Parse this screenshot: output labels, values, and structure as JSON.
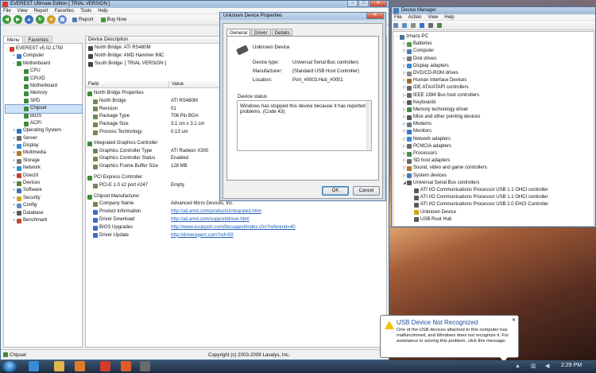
{
  "everest": {
    "title": "EVEREST Ultimate Edition  [ TRIAL VERSION ]",
    "menu": [
      "File",
      "View",
      "Report",
      "Favorites",
      "Tools",
      "Help"
    ],
    "report_label": "Report",
    "buynow_label": "Buy Now",
    "tabs": [
      "Menu",
      "Favorites"
    ],
    "tree": [
      {
        "label": "EVEREST v5.02.1750",
        "level": 0,
        "color": "#d33b2c"
      },
      {
        "label": "Computer",
        "level": 1,
        "color": "#3c7bd1",
        "exp": "+"
      },
      {
        "label": "Motherboard",
        "level": 1,
        "color": "#3f8a3f",
        "exp": "−"
      },
      {
        "label": "CPU",
        "level": 2,
        "color": "#3f8a3f"
      },
      {
        "label": "CPUID",
        "level": 2,
        "color": "#3f8a3f"
      },
      {
        "label": "Motherboard",
        "level": 2,
        "color": "#3f8a3f"
      },
      {
        "label": "Memory",
        "level": 2,
        "color": "#3f8a3f"
      },
      {
        "label": "SPD",
        "level": 2,
        "color": "#3f8a3f"
      },
      {
        "label": "Chipset",
        "level": 2,
        "color": "#3f8a3f",
        "selected": true
      },
      {
        "label": "BIOS",
        "level": 2,
        "color": "#3f8a3f"
      },
      {
        "label": "ACPI",
        "level": 2,
        "color": "#3f8a3f"
      },
      {
        "label": "Operating System",
        "level": 1,
        "color": "#2f6fc4",
        "exp": "+"
      },
      {
        "label": "Server",
        "level": 1,
        "color": "#6a6a6a",
        "exp": "+"
      },
      {
        "label": "Display",
        "level": 1,
        "color": "#3a8ad6",
        "exp": "+"
      },
      {
        "label": "Multimedia",
        "level": 1,
        "color": "#b07a2a",
        "exp": "+"
      },
      {
        "label": "Storage",
        "level": 1,
        "color": "#7a7a7a",
        "exp": "+"
      },
      {
        "label": "Network",
        "level": 1,
        "color": "#2f8fd1",
        "exp": "+"
      },
      {
        "label": "DirectX",
        "level": 1,
        "color": "#c23a3a",
        "exp": "+"
      },
      {
        "label": "Devices",
        "level": 1,
        "color": "#5a7f3a",
        "exp": "+"
      },
      {
        "label": "Software",
        "level": 1,
        "color": "#3c6fb8",
        "exp": "+"
      },
      {
        "label": "Security",
        "level": 1,
        "color": "#d1a22a",
        "exp": "+"
      },
      {
        "label": "Config",
        "level": 1,
        "color": "#5a8fc4",
        "exp": "+"
      },
      {
        "label": "Database",
        "level": 1,
        "color": "#5a5a5a",
        "exp": "+"
      },
      {
        "label": "Benchmark",
        "level": 1,
        "color": "#c24a2a",
        "exp": "+"
      }
    ],
    "device_desc_header": "Device Description",
    "device_desc": [
      "North Bridge: ATI RS480M",
      "North Bridge: AMD Hammer IMC",
      "South Bridge: [ TRIAL VERSION ]"
    ],
    "col_field": "Field",
    "col_value": "Value",
    "groups": [
      {
        "title": "North Bridge Properties",
        "rows": [
          [
            "North Bridge",
            "ATI RS480M",
            false
          ],
          [
            "Revision",
            "01",
            false
          ],
          [
            "Package Type",
            "706 Pin BGA",
            false
          ],
          [
            "Package Size",
            "3.1 cm x 3.1 cm",
            false
          ],
          [
            "Process Technology",
            "0.13 um",
            false
          ]
        ]
      },
      {
        "title": "Integrated Graphics Controller",
        "rows": [
          [
            "Graphics Controller Type",
            "ATI Radeon X300",
            false
          ],
          [
            "Graphics Controller Status",
            "Enabled",
            false
          ],
          [
            "Graphics Frame Buffer Size",
            "128 MB",
            false
          ]
        ]
      },
      {
        "title": "PCI Express Controller",
        "rows": [
          [
            "PCI-E 1.0 x2 port #247",
            "Empty",
            false
          ]
        ]
      },
      {
        "title": "Chipset Manufacturer",
        "rows": [
          [
            "Company Name",
            "Advanced Micro Devices, Inc.",
            false
          ],
          [
            "Product Information",
            "http://ati.amd.com/products/integrated.html",
            true
          ],
          [
            "Driver Download",
            "http://ati.amd.com/support/driver.html",
            true
          ],
          [
            "BIOS Upgrades",
            "http://www.esupport.com/biosagent/index.cfm?refererid=40",
            true
          ],
          [
            "Driver Update",
            "http://driveragent.com?ref=59",
            true
          ]
        ]
      }
    ],
    "status_left": "Chipset",
    "status_right": "Copyright (c) 2003-2009 Lavalys, Inc."
  },
  "dialog": {
    "title": "Unknown Device Properties",
    "tabs": [
      "General",
      "Driver",
      "Details"
    ],
    "device_name": "Unknown Device",
    "props": [
      [
        "Device type:",
        "Universal Serial Bus controllers"
      ],
      [
        "Manufacturer:",
        "(Standard USB Host Controller)"
      ],
      [
        "Location:",
        "Port_#0003.Hub_#0001"
      ]
    ],
    "status_label": "Device status",
    "status_text": "Windows has stopped this device because it has reported problems. (Code 43)",
    "ok": "OK",
    "cancel": "Cancel"
  },
  "devmgr": {
    "title": "Device Manager",
    "menu": [
      "File",
      "Action",
      "View",
      "Help"
    ],
    "tree": [
      {
        "label": "zmanz-PC",
        "level": 0,
        "color": "#4a6f96",
        "exp": "−"
      },
      {
        "label": "Batteries",
        "level": 1,
        "color": "#4b9b3c",
        "exp": "▷"
      },
      {
        "label": "Computer",
        "level": 1,
        "color": "#4a7ab8",
        "exp": "▷"
      },
      {
        "label": "Disk drives",
        "level": 1,
        "color": "#7a7a7a",
        "exp": "▷"
      },
      {
        "label": "Display adapters",
        "level": 1,
        "color": "#3a8ad6",
        "exp": "▷"
      },
      {
        "label": "DVD/CD-ROM drives",
        "level": 1,
        "color": "#8a8a8a",
        "exp": "▷"
      },
      {
        "label": "Human Interface Devices",
        "level": 1,
        "color": "#a06a2a",
        "exp": "▷"
      },
      {
        "label": "IDE ATA/ATAPI controllers",
        "level": 1,
        "color": "#6a6a6a",
        "exp": "▷"
      },
      {
        "label": "IEEE 1394 Bus host controllers",
        "level": 1,
        "color": "#6a6a6a",
        "exp": "▷"
      },
      {
        "label": "Keyboards",
        "level": 1,
        "color": "#5a5a5a",
        "exp": "▷"
      },
      {
        "label": "Memory technology driver",
        "level": 1,
        "color": "#4a8a4a",
        "exp": "▷"
      },
      {
        "label": "Mice and other pointing devices",
        "level": 1,
        "color": "#5a5a5a",
        "exp": "▷"
      },
      {
        "label": "Modems",
        "level": 1,
        "color": "#6a7a8a",
        "exp": "▷"
      },
      {
        "label": "Monitors",
        "level": 1,
        "color": "#3a7ac4",
        "exp": "▷"
      },
      {
        "label": "Network adapters",
        "level": 1,
        "color": "#3a8ad6",
        "exp": "▷"
      },
      {
        "label": "PCMCIA adapters",
        "level": 1,
        "color": "#6a6a6a",
        "exp": "▷"
      },
      {
        "label": "Processors",
        "level": 1,
        "color": "#4a8a4a",
        "exp": "▷"
      },
      {
        "label": "SD host adapters",
        "level": 1,
        "color": "#6a6a6a",
        "exp": "▷"
      },
      {
        "label": "Sound, video and game controllers",
        "level": 1,
        "color": "#b07a2a",
        "exp": "▷"
      },
      {
        "label": "System devices",
        "level": 1,
        "color": "#4a7ab8",
        "exp": "▷"
      },
      {
        "label": "Universal Serial Bus controllers",
        "level": 1,
        "color": "#5a5a5a",
        "exp": "◢"
      },
      {
        "label": "ATI I/O Communications Processor USB 1.1 OHCI controller",
        "level": 2,
        "color": "#5a5a5a"
      },
      {
        "label": "ATI I/O Communications Processor USB 1.1 OHCI controller",
        "level": 2,
        "color": "#5a5a5a"
      },
      {
        "label": "ATI I/O Communications Processor USB 2.0 EHCI Controller",
        "level": 2,
        "color": "#5a5a5a"
      },
      {
        "label": "Unknown Device",
        "level": 2,
        "color": "#d7a01e"
      },
      {
        "label": "USB Root Hub",
        "level": 2,
        "color": "#5a5a5a"
      }
    ]
  },
  "balloon": {
    "title": "USB Device Not Recognized",
    "text": "One of the USB devices attached to this computer has malfunctioned, and Windows does not recognize it. For assistance in solving this problem, click this message."
  },
  "taskbar": {
    "clock": "2:29 PM"
  }
}
